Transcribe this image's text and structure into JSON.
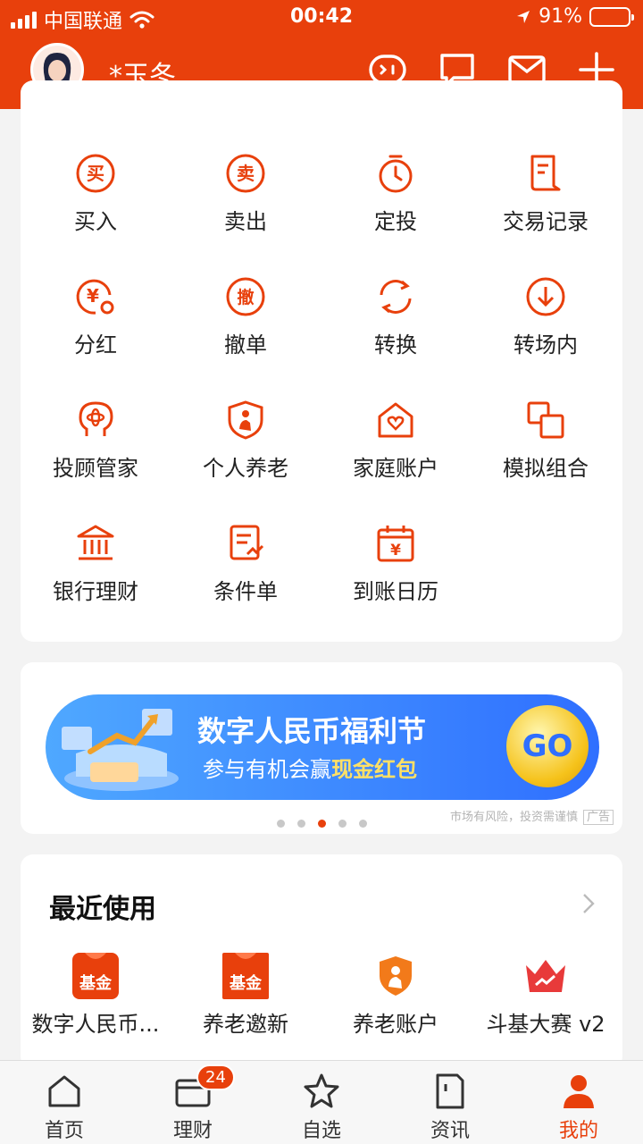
{
  "status_bar": {
    "carrier": "中国联通",
    "time": "00:42",
    "battery": "91%"
  },
  "header": {
    "username": "*玉冬",
    "icons": [
      "robot-chat-icon",
      "message-icon",
      "mail-icon",
      "plus-icon"
    ]
  },
  "quick_trade": {
    "items": [
      {
        "label": "买入",
        "icon": "buy-icon"
      },
      {
        "label": "卖出",
        "icon": "sell-icon"
      },
      {
        "label": "定投",
        "icon": "timer-icon"
      },
      {
        "label": "交易记录",
        "icon": "record-icon"
      },
      {
        "label": "分红",
        "icon": "dividend-icon"
      },
      {
        "label": "撤单",
        "icon": "cancel-order-icon"
      },
      {
        "label": "转换",
        "icon": "switch-icon"
      },
      {
        "label": "转场内",
        "icon": "transfer-icon"
      },
      {
        "label": "投顾管家",
        "icon": "advisor-icon"
      },
      {
        "label": "个人养老",
        "icon": "pension-icon"
      },
      {
        "label": "家庭账户",
        "icon": "family-icon"
      },
      {
        "label": "模拟组合",
        "icon": "portfolio-icon"
      },
      {
        "label": "银行理财",
        "icon": "bank-icon"
      },
      {
        "label": "条件单",
        "icon": "condition-order-icon"
      },
      {
        "label": "到账日历",
        "icon": "calendar-icon"
      }
    ]
  },
  "banner": {
    "title": "数字人民币福利节",
    "subtitle_prefix": "参与有机会赢",
    "subtitle_highlight": "现金红包",
    "go_label": "GO",
    "risk_text": "市场有风险，投资需谨慎",
    "ad_label": "广告",
    "active_page": 3,
    "page_count": 5
  },
  "recent": {
    "title": "最近使用",
    "items": [
      {
        "label": "数字人民币...",
        "icon": "fund-icon",
        "icon_text": "基金"
      },
      {
        "label": "养老邀新",
        "icon": "fund-icon",
        "icon_text": "基金"
      },
      {
        "label": "养老账户",
        "icon": "pension-shield-icon",
        "icon_text": ""
      },
      {
        "label": "斗基大赛 v2",
        "icon": "crown-icon",
        "icon_text": ""
      }
    ]
  },
  "tabbar": {
    "tabs": [
      {
        "label": "首页",
        "icon": "home-icon"
      },
      {
        "label": "理财",
        "icon": "wallet-icon",
        "badge": "24"
      },
      {
        "label": "自选",
        "icon": "star-icon"
      },
      {
        "label": "资讯",
        "icon": "news-icon"
      },
      {
        "label": "我的",
        "icon": "user-icon",
        "active": true
      }
    ]
  },
  "colors": {
    "brand": "#e8400c",
    "banner": "#2f6fff"
  }
}
